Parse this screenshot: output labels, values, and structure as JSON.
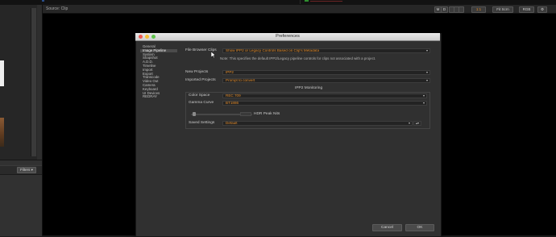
{
  "viewer": {
    "source_label": "Source: Clip",
    "toolbar_buttons": [
      "M",
      "D",
      "1:1",
      "Fit Scrn",
      "RGB"
    ]
  },
  "left_panel": {
    "filters_label": "Filters ▾"
  },
  "dialog": {
    "title": "Preferences",
    "categories": [
      "General",
      "Image Pipeline",
      "System",
      "Snapshot",
      "A.D.D.",
      "Timeline",
      "Import",
      "Export",
      "Transcode",
      "Video Out",
      "Camera",
      "Keyboard",
      "UI Devices",
      "REDRAY"
    ],
    "selected_category": "Image Pipeline",
    "file_browser_clips": {
      "label": "File Browser Clips",
      "value": "Show IPP2 or Legacy Controls Based on Clip's Metadata",
      "note": "Note: This specifies the default IPP2/Legacy pipeline controls for clips not associated with a project."
    },
    "new_projects": {
      "label": "New Projects",
      "value": "IPP2"
    },
    "imported_projects": {
      "label": "Imported Projects",
      "value": "Prompt to convert"
    },
    "ipp2_monitoring": {
      "title": "IPP2 Monitoring",
      "color_space": {
        "label": "Color Space",
        "value": "REC 709"
      },
      "gamma_curve": {
        "label": "Gamma Curve",
        "value": "BT1886"
      },
      "hdr_peak_nits_label": "HDR Peak Nits",
      "saved_settings": {
        "label": "Saved Settings",
        "value": "Default"
      }
    },
    "cancel_label": "Cancel",
    "ok_label": "OK"
  },
  "colors": {
    "accent_orange": "#e08a2a",
    "close": "#ee5a52",
    "minimize": "#f4bd31",
    "maximize": "#5fc34a"
  }
}
